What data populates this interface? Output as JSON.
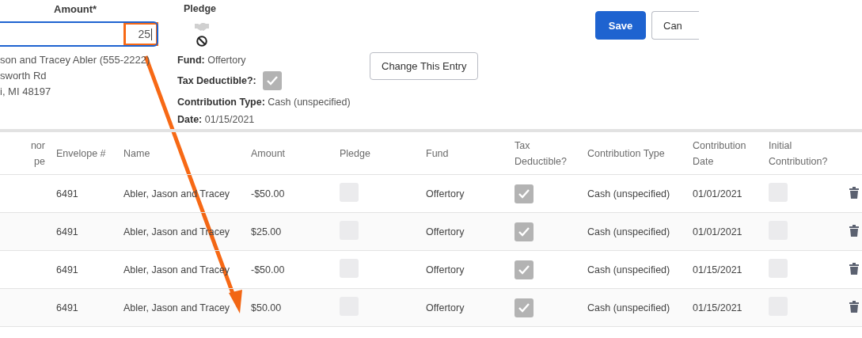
{
  "form": {
    "amount_label": "Amount*",
    "amount_value": "25",
    "pledge_label": "Pledge",
    "donor_lines": [
      "son and Tracey Abler (555-2222)",
      "sworth Rd",
      "i, MI 48197"
    ],
    "fund": {
      "label": "Fund:",
      "value": "Offertory"
    },
    "tax_deductible": {
      "label": "Tax Deductible?:",
      "checked": true
    },
    "details": [
      {
        "label": "Contribution Type:",
        "value": "Cash (unspecified)"
      },
      {
        "label": "Date:",
        "value": "01/15/2021"
      }
    ],
    "change_button": "Change This Entry",
    "save_button": "Save",
    "cancel_button": "Can"
  },
  "table": {
    "columns": [
      "nor pe",
      "Envelope #",
      "Name",
      "Amount",
      "Pledge",
      "Fund",
      "Tax Deductible?",
      "Contribution Type",
      "Contribution Date",
      "Initial Contribution?"
    ],
    "rows": [
      {
        "envelope": "6491",
        "name": "Abler, Jason and Tracey",
        "amount": "-$50.00",
        "pledge": false,
        "fund": "Offertory",
        "tax_deductible": true,
        "type": "Cash (unspecified)",
        "date": "01/01/2021",
        "initial": false
      },
      {
        "envelope": "6491",
        "name": "Abler, Jason and Tracey",
        "amount": "$25.00",
        "pledge": false,
        "fund": "Offertory",
        "tax_deductible": true,
        "type": "Cash (unspecified)",
        "date": "01/01/2021",
        "initial": false
      },
      {
        "envelope": "6491",
        "name": "Abler, Jason and Tracey",
        "amount": "-$50.00",
        "pledge": false,
        "fund": "Offertory",
        "tax_deductible": true,
        "type": "Cash (unspecified)",
        "date": "01/15/2021",
        "initial": false
      },
      {
        "envelope": "6491",
        "name": "Abler, Jason and Tracey",
        "amount": "$50.00",
        "pledge": false,
        "fund": "Offertory",
        "tax_deductible": true,
        "type": "Cash (unspecified)",
        "date": "01/15/2021",
        "initial": false
      }
    ]
  }
}
